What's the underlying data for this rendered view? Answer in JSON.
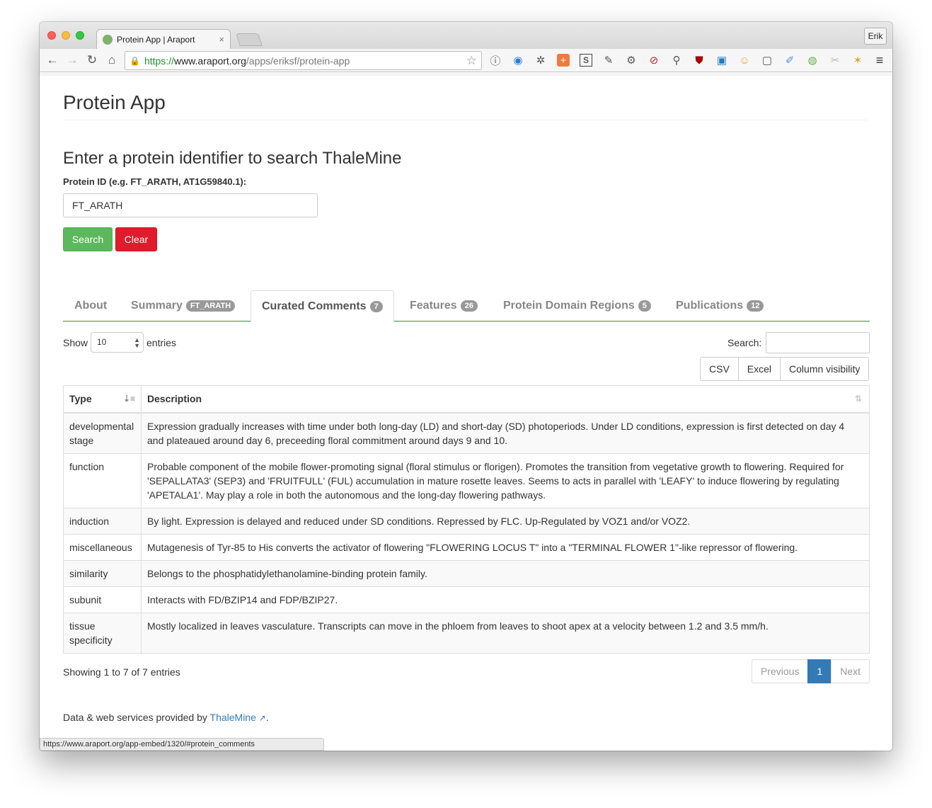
{
  "browser": {
    "tab_title": "Protein App | Araport",
    "tab_close": "×",
    "profile_name": "Erik",
    "url_scheme": "https://",
    "url_host": "www.araport.org",
    "url_path": "/apps/eriksf/protein-app",
    "status_url": "https://www.araport.org/app-embed/1320/#protein_comments"
  },
  "app": {
    "title": "Protein App",
    "search_heading": "Enter a protein identifier to search ThaleMine",
    "input_label": "Protein ID (e.g. FT_ARATH, AT1G59840.1):",
    "input_value": "FT_ARATH",
    "search_button": "Search",
    "clear_button": "Clear"
  },
  "tabs": [
    {
      "label": "About",
      "badge": ""
    },
    {
      "label": "Summary",
      "badge": "FT_ARATH"
    },
    {
      "label": "Curated Comments",
      "badge": "7"
    },
    {
      "label": "Features",
      "badge": "26"
    },
    {
      "label": "Protein Domain Regions",
      "badge": "5"
    },
    {
      "label": "Publications",
      "badge": "12"
    }
  ],
  "table_controls": {
    "show_label": "Show",
    "length_value": "10",
    "entries_label": "entries",
    "search_label": "Search:",
    "export_buttons": [
      "CSV",
      "Excel",
      "Column visibility"
    ]
  },
  "table": {
    "columns": [
      "Type",
      "Description"
    ],
    "rows": [
      {
        "type": "developmental stage",
        "description": "Expression gradually increases with time under both long-day (LD) and short-day (SD) photoperiods. Under LD conditions, expression is first detected on day 4 and plateaued around day 6, preceeding floral commitment around days 9 and 10."
      },
      {
        "type": "function",
        "description": "Probable component of the mobile flower-promoting signal (floral stimulus or florigen). Promotes the transition from vegetative growth to flowering. Required for 'SEPALLATA3' (SEP3) and 'FRUITFULL' (FUL) accumulation in mature rosette leaves. Seems to acts in parallel with 'LEAFY' to induce flowering by regulating 'APETALA1'. May play a role in both the autonomous and the long-day flowering pathways."
      },
      {
        "type": "induction",
        "description": "By light. Expression is delayed and reduced under SD conditions. Repressed by FLC. Up-Regulated by VOZ1 and/or VOZ2."
      },
      {
        "type": "miscellaneous",
        "description": "Mutagenesis of Tyr-85 to His converts the activator of flowering \"FLOWERING LOCUS T\" into a \"TERMINAL FLOWER 1\"-like repressor of flowering."
      },
      {
        "type": "similarity",
        "description": "Belongs to the phosphatidylethanolamine-binding protein family."
      },
      {
        "type": "subunit",
        "description": "Interacts with FD/BZIP14 and FDP/BZIP27."
      },
      {
        "type": "tissue specificity",
        "description": "Mostly localized in leaves vasculature. Transcripts can move in the phloem from leaves to shoot apex at a velocity between 1.2 and 3.5 mm/h."
      }
    ]
  },
  "pagination": {
    "info": "Showing 1 to 7 of 7 entries",
    "previous": "Previous",
    "current": "1",
    "next": "Next"
  },
  "footer": {
    "prefix": "Data & web services provided by ",
    "link": "ThaleMine",
    "suffix": "."
  },
  "colors": {
    "search_btn": "#5cb85c",
    "clear_btn": "#e01b2b",
    "tab_underline": "#3c8d3c",
    "link": "#337ab7"
  }
}
